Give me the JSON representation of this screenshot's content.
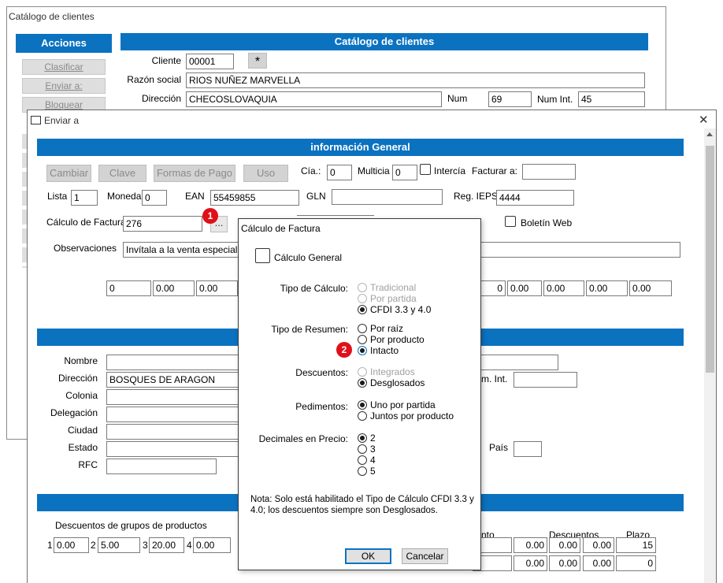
{
  "back_window": {
    "title": "Catálogo de clientes",
    "actions_header": "Acciones",
    "actions": [
      "Clasificar",
      "Enviar a:",
      "Bloquear"
    ],
    "header": "Catálogo de clientes",
    "cliente_label": "Cliente",
    "cliente_value": "00001",
    "star_button": "*",
    "razon_label": "Razón social",
    "razon_value": "RIOS NUÑEZ MARVELLA",
    "direccion_label": "Dirección",
    "direccion_value": "CHECOSLOVAQUIA",
    "num_label": "Num",
    "num_value": "69",
    "numint_label": "Num Int.",
    "numint_value": "45"
  },
  "enviar": {
    "title": "Enviar a",
    "close_glyph": "✕",
    "info_header": "información General",
    "buttons": [
      "Cambiar",
      "Clave",
      "Formas de Pago",
      "Uso"
    ],
    "cia_label": "Cía.:",
    "cia_value": "0",
    "multicia_label": "Multicia",
    "multicia_value": "0",
    "intercia_label": "Intercía",
    "facturar_label": "Facturar a:",
    "lista_label": "Lista",
    "lista_value": "1",
    "moneda_label": "Moneda",
    "moneda_value": "0",
    "ean_label": "EAN",
    "ean_value": "55459855",
    "gln_label": "GLN",
    "reg_label": "Reg. IEPS",
    "reg_value": "4444",
    "calculo_label": "Cálculo de Factura",
    "calculo_value": "276",
    "ellipsis": "...",
    "boletin_label": "Boletín Web",
    "obs_label": "Observaciones",
    "obs_value": "Invítala a la venta especial c",
    "row_left": [
      "0",
      "0.00",
      "0.00"
    ],
    "row_right": [
      "0",
      "0.00",
      "0.00",
      "0.00",
      "0.00"
    ],
    "nombre_label": "Nombre",
    "direccion_label": "Dirección",
    "direccion_value": "BOSQUES DE ARAGON",
    "colonia_label": "Colonia",
    "delegacion_label": "Delegación",
    "ciudad_label": "Ciudad",
    "estado_label": "Estado",
    "rfc_label": "RFC",
    "numint_label": "m. Int.",
    "pais_label": "País",
    "desc_grupos_label": "Descuentos de grupos de productos",
    "grupos": [
      {
        "n": "1",
        "v": "0.00"
      },
      {
        "n": "2",
        "v": "5.00"
      },
      {
        "n": "3",
        "v": "20.00"
      },
      {
        "n": "4",
        "v": "0.00"
      }
    ],
    "nto_label": "nto",
    "descuentos_label": "Descuentos",
    "plazo_label": "Plazo",
    "grid_row1": [
      "0.00",
      "0.00",
      "0.00",
      "15"
    ],
    "grid_row2": [
      "0.00",
      "0.00",
      "0.00",
      "0"
    ]
  },
  "dialog": {
    "title": "Cálculo de Factura",
    "calculo_general": "Cálculo General",
    "tipo_calculo_label": "Tipo de Cálculo:",
    "tipo_calculo": [
      "Tradicional",
      "Por partida",
      "CFDI 3.3 y 4.0"
    ],
    "tipo_resumen_label": "Tipo de Resumen:",
    "tipo_resumen": [
      "Por raíz",
      "Por producto",
      "Intacto"
    ],
    "descuentos_label": "Descuentos:",
    "descuentos": [
      "Integrados",
      "Desglosados"
    ],
    "pedimentos_label": "Pedimentos:",
    "pedimentos": [
      "Uno por partida",
      "Juntos por producto"
    ],
    "decimales_label": "Decimales en Precio:",
    "decimales": [
      "2",
      "3",
      "4",
      "5"
    ],
    "nota": "Nota: Solo está habilitado el Tipo de Cálculo CFDI 3.3 y 4.0; los descuentos siempre son Desglosados.",
    "ok": "OK",
    "cancelar": "Cancelar"
  },
  "badges": {
    "one": "1",
    "two": "2"
  }
}
